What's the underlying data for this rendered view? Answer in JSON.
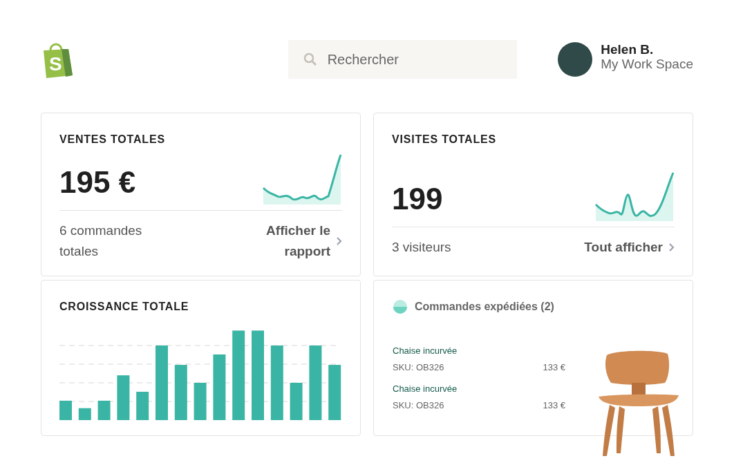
{
  "logo": {
    "letter": "S"
  },
  "search": {
    "placeholder": "Rechercher"
  },
  "user": {
    "name": "Helen B.",
    "workspace": "My Work Space"
  },
  "sales": {
    "title": "VENTES TOTALES",
    "value": "195 €",
    "subtitle": "6 commandes totales",
    "link": "Afficher le rapport"
  },
  "visits": {
    "title": "VISITES TOTALES",
    "value": "199",
    "subtitle": "3 visiteurs",
    "link": "Tout afficher"
  },
  "growth": {
    "title": "CROISSANCE TOTALE"
  },
  "shipped": {
    "title": "Commandes expédiées (2)",
    "items": [
      {
        "name": "Chaise incurvée",
        "sku": "SKU: OB326",
        "price": "133 €"
      },
      {
        "name": "Chaise incurvée",
        "sku": "SKU: OB326",
        "price": "133 €"
      }
    ]
  }
}
